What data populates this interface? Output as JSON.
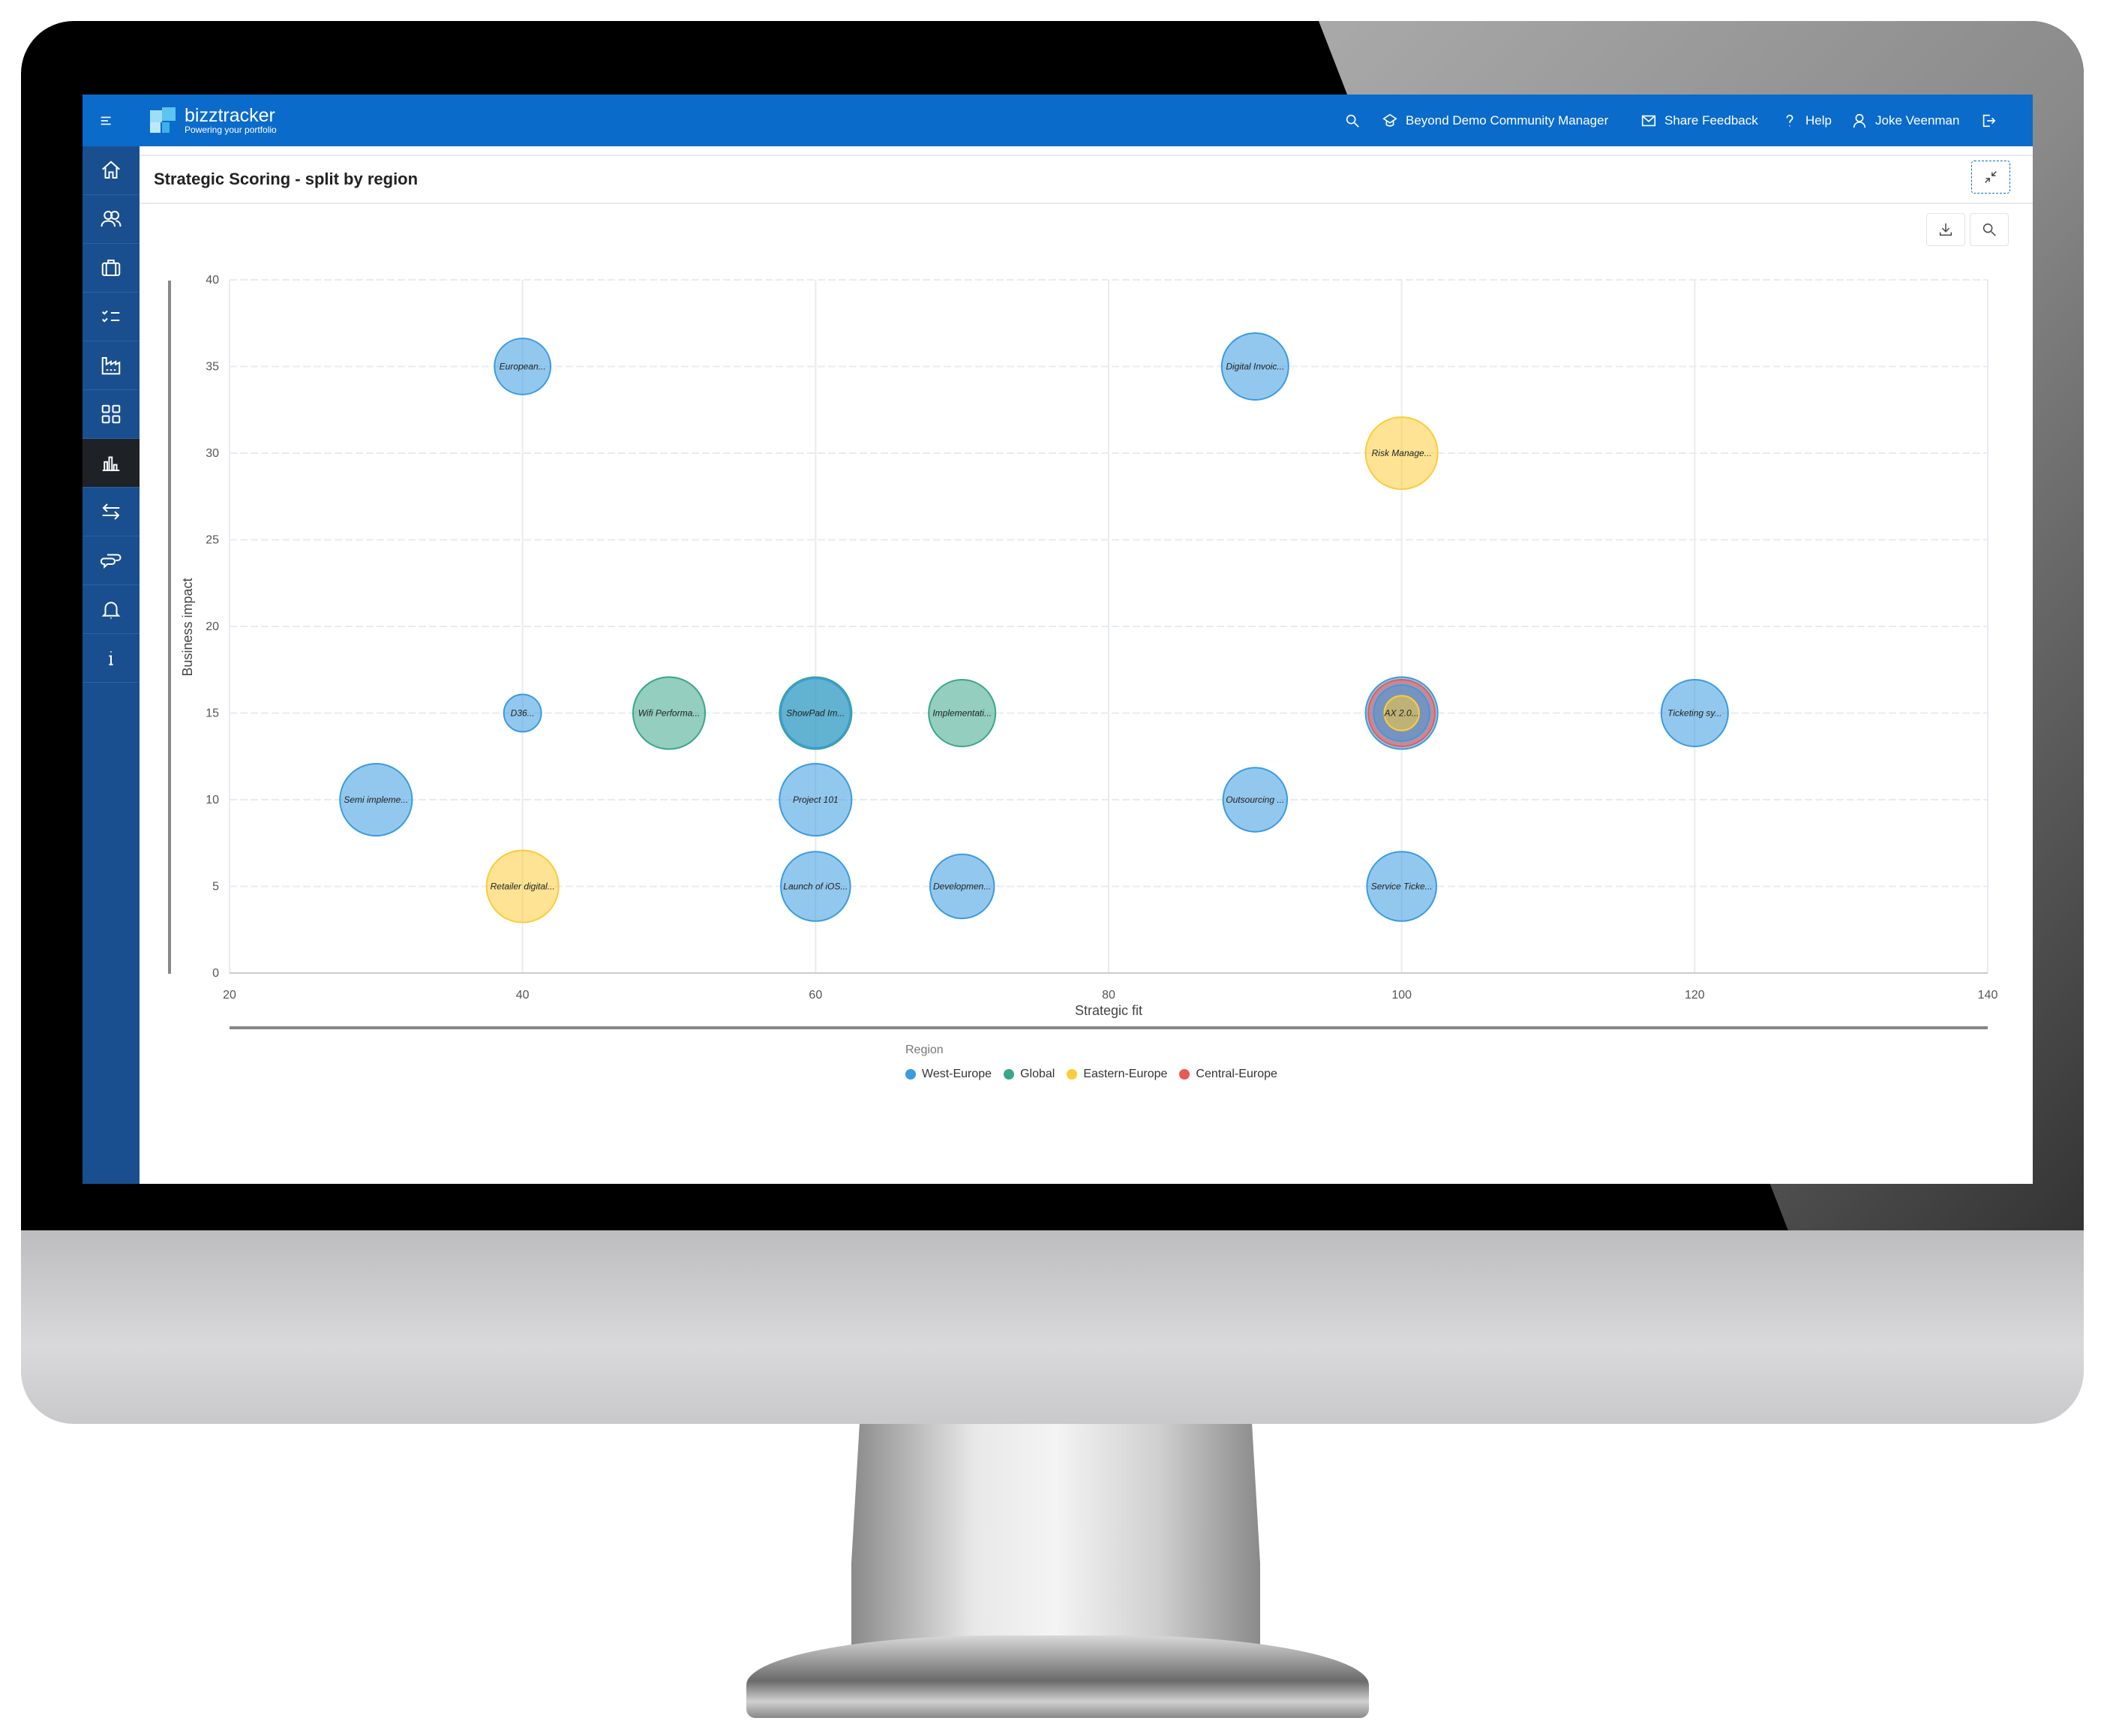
{
  "header": {
    "brand": "bizztracker",
    "tagline": "Powering your portfolio",
    "community": "Beyond Demo Community Manager",
    "feedback": "Share Feedback",
    "help": "Help",
    "user": "Joke Veenman"
  },
  "sidebar": {
    "items": [
      {
        "icon": "home-icon"
      },
      {
        "icon": "users-icon"
      },
      {
        "icon": "briefcase-icon"
      },
      {
        "icon": "checklist-icon"
      },
      {
        "icon": "factory-icon"
      },
      {
        "icon": "grid-icon"
      },
      {
        "icon": "bar-chart-icon",
        "active": true
      },
      {
        "icon": "exchange-icon"
      },
      {
        "icon": "chat-icon"
      },
      {
        "icon": "bell-icon"
      },
      {
        "icon": "info-icon"
      }
    ]
  },
  "page": {
    "title": "Strategic Scoring - split by region"
  },
  "chart_data": {
    "type": "scatter",
    "subtype": "bubble",
    "xlabel": "Strategic fit",
    "ylabel": "Business impact",
    "xlim": [
      20,
      140
    ],
    "ylim": [
      0,
      40
    ],
    "xticks": [
      20,
      40,
      60,
      80,
      100,
      120,
      140
    ],
    "yticks": [
      0,
      5,
      10,
      15,
      20,
      25,
      30,
      35,
      40
    ],
    "grid": true,
    "legend": {
      "title": "Region",
      "placement": "bottom"
    },
    "series": [
      {
        "name": "West-Europe",
        "color": "#3a9be0",
        "points": [
          {
            "x": 40,
            "y": 35,
            "z": 21,
            "label": "European..."
          },
          {
            "x": 90,
            "y": 35,
            "z": 25,
            "label": "Digital Invoic..."
          },
          {
            "x": 40,
            "y": 15,
            "z": 14,
            "label": "D36..."
          },
          {
            "x": 60,
            "y": 15,
            "z": 26,
            "label": "ShowPad Im..."
          },
          {
            "x": 100,
            "y": 15,
            "z": 27,
            "label": ""
          },
          {
            "x": 100,
            "y": 15,
            "z": 21,
            "label": ""
          },
          {
            "x": 120,
            "y": 15,
            "z": 25,
            "label": "Ticketing sy..."
          },
          {
            "x": 30,
            "y": 10,
            "z": 27,
            "label": "Semi impleme..."
          },
          {
            "x": 60,
            "y": 10,
            "z": 27,
            "label": "Project 101"
          },
          {
            "x": 90,
            "y": 10,
            "z": 24,
            "label": "Outsourcing ..."
          },
          {
            "x": 60,
            "y": 5,
            "z": 26,
            "label": "Launch of iOS..."
          },
          {
            "x": 70,
            "y": 5,
            "z": 24,
            "label": "Developmen..."
          },
          {
            "x": 100,
            "y": 5,
            "z": 26,
            "label": "Service Ticke..."
          }
        ]
      },
      {
        "name": "Global",
        "color": "#3aa68a",
        "points": [
          {
            "x": 50,
            "y": 15,
            "z": 27,
            "label": "Wifi Performa..."
          },
          {
            "x": 60,
            "y": 15,
            "z": 27,
            "label": ""
          },
          {
            "x": 70,
            "y": 15,
            "z": 25,
            "label": "Implementati..."
          }
        ]
      },
      {
        "name": "Eastern-Europe",
        "color": "#fccc3a",
        "points": [
          {
            "x": 100,
            "y": 30,
            "z": 27,
            "label": "Risk Manage..."
          },
          {
            "x": 40,
            "y": 5,
            "z": 27,
            "label": "Retailer digital..."
          },
          {
            "x": 100,
            "y": 15,
            "z": 13,
            "label": "AX 2.0..."
          }
        ]
      },
      {
        "name": "Central-Europe",
        "color": "#e85a56",
        "points": [
          {
            "x": 100,
            "y": 15,
            "z": 25,
            "label": ""
          }
        ]
      }
    ]
  }
}
